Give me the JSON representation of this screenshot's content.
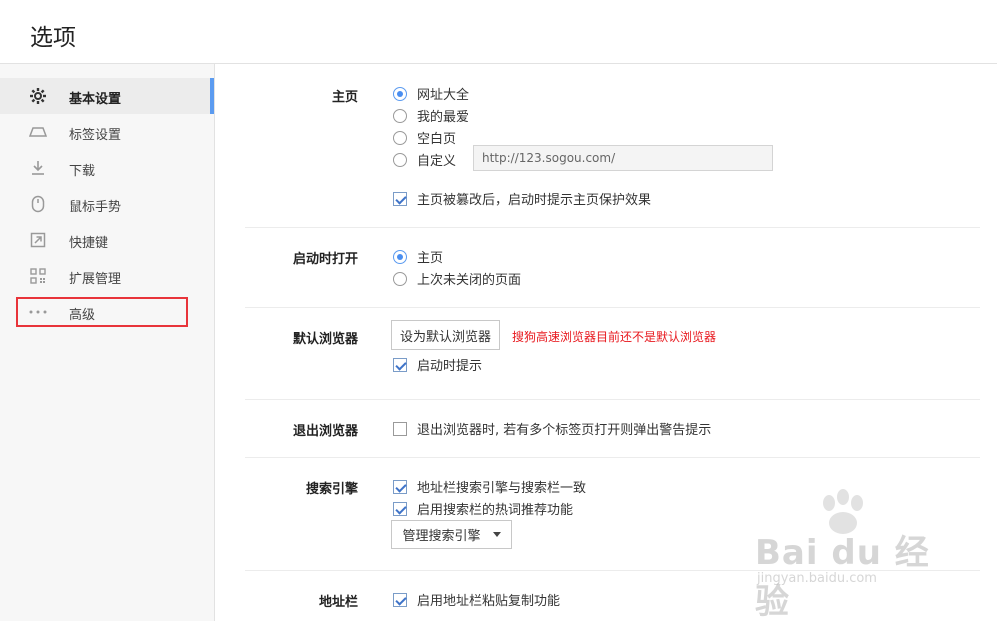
{
  "window": {
    "title": "选项"
  },
  "sidebar": {
    "items": [
      {
        "label": "基本设置",
        "icon": "gear-icon",
        "active": true
      },
      {
        "label": "标签设置",
        "icon": "tab-icon"
      },
      {
        "label": "下载",
        "icon": "download-icon"
      },
      {
        "label": "鼠标手势",
        "icon": "mouse-icon"
      },
      {
        "label": "快捷键",
        "icon": "shortcut-icon"
      },
      {
        "label": "扩展管理",
        "icon": "extensions-icon"
      },
      {
        "label": "高级",
        "icon": "more-dots-icon",
        "highlighted": true
      }
    ]
  },
  "homepage": {
    "label": "主页",
    "options": [
      "网址大全",
      "我的最爱",
      "空白页",
      "自定义"
    ],
    "selected": "网址大全",
    "custom_url": "http://123.sogou.com/",
    "protect_check": "主页被篡改后，启动时提示主页保护效果",
    "protect_checked": true
  },
  "startup": {
    "label": "启动时打开",
    "options": [
      "主页",
      "上次未关闭的页面"
    ],
    "selected": "主页"
  },
  "default_browser": {
    "label": "默认浏览器",
    "button": "设为默认浏览器",
    "warning": "搜狗高速浏览器目前还不是默认浏览器",
    "check": "启动时提示",
    "checked": true
  },
  "exit": {
    "label": "退出浏览器",
    "check": "退出浏览器时, 若有多个标签页打开则弹出警告提示",
    "checked": false
  },
  "search": {
    "label": "搜索引擎",
    "checks": [
      "地址栏搜索引擎与搜索栏一致",
      "启用搜索栏的热词推荐功能"
    ],
    "button": "管理搜索引擎"
  },
  "addressbar": {
    "label": "地址栏",
    "check": "启用地址栏粘贴复制功能",
    "checked": true
  },
  "watermark": {
    "brand": "Bai du 经验",
    "url": "jingyan.baidu.com"
  },
  "colors": {
    "accent": "#5b9bf0",
    "warning": "#e8181e",
    "highlight_box": "#e8343a"
  }
}
